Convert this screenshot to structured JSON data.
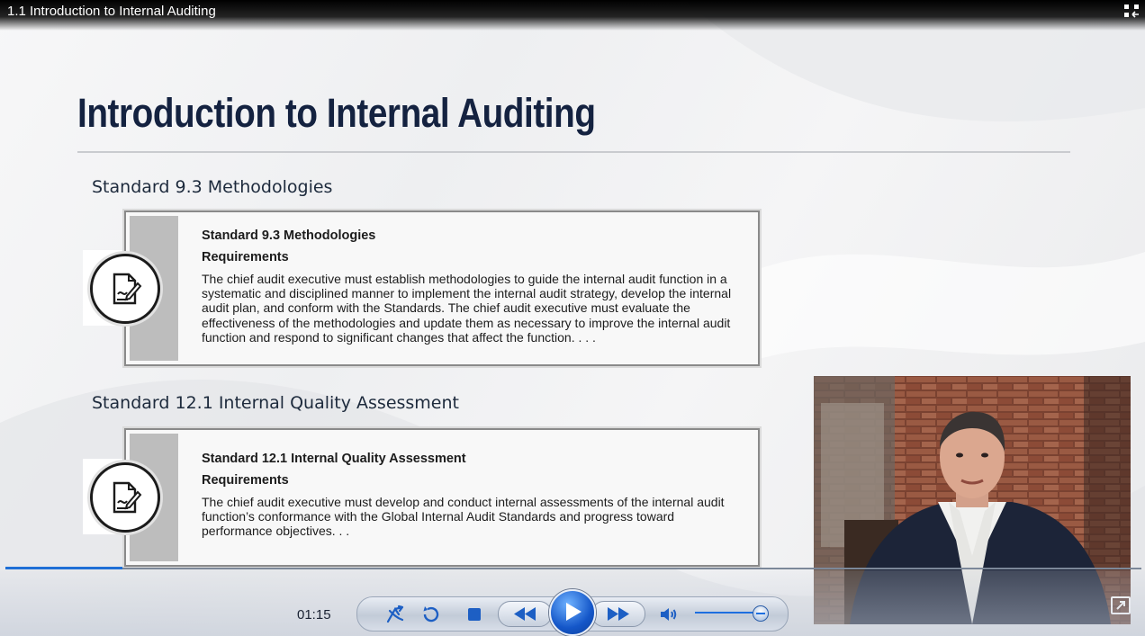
{
  "window": {
    "title": "1.1 Introduction to Internal Auditing"
  },
  "slide": {
    "title": "Introduction to Internal Auditing",
    "sections": [
      {
        "heading": "Standard 9.3 Methodologies",
        "card_title": "Standard 9.3 Methodologies",
        "card_subtitle": "Requirements",
        "card_text": "The chief audit executive must establish methodologies to guide the internal audit function in a systematic and disciplined manner to implement the internal audit strategy, develop the internal audit plan, and conform with the Standards. The chief audit executive must evaluate the effectiveness of the methodologies and update them as necessary to improve the internal audit function and respond to significant changes that affect the function. . . ."
      },
      {
        "heading": "Standard 12.1 Internal Quality Assessment",
        "card_title": "Standard 12.1 Internal Quality Assessment",
        "card_subtitle": "Requirements",
        "card_text": "The chief audit executive must develop and conduct internal assessments of the internal audit function’s conformance with the Global Internal Audit Standards and progress toward performance objectives. . ."
      }
    ]
  },
  "player": {
    "elapsed": "01:15",
    "progress_fraction": 0.103,
    "volume_fraction": 0.9,
    "accent_color": "#1f6fd6",
    "icons": {
      "exit_fullscreen": "exit-fullscreen-icon",
      "switch": "switch-icon",
      "replay": "replay-icon",
      "stop": "stop-icon",
      "rewind": "rewind-icon",
      "play": "play-icon",
      "fast_forward": "fast-forward-icon",
      "volume": "volume-icon",
      "popout": "popout-icon"
    }
  }
}
